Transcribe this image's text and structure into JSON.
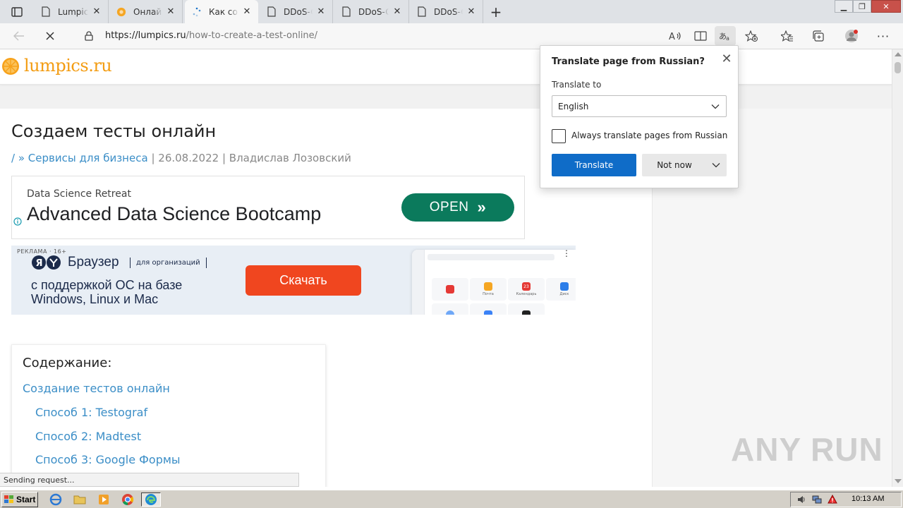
{
  "tabs": [
    {
      "title": "Lumpics",
      "icon": "page-icon"
    },
    {
      "title": "Онлайн",
      "icon": "orange-favicon"
    },
    {
      "title": "Как создать",
      "icon": "loading-spinner-icon"
    },
    {
      "title": "DDoS-G",
      "icon": "page-icon"
    },
    {
      "title": "DDoS-G",
      "icon": "page-icon"
    },
    {
      "title": "DDoS-G",
      "icon": "page-icon"
    }
  ],
  "toolbar": {
    "url_scheme_host": "https://lumpics.ru",
    "url_path": "/how-to-create-a-test-online/"
  },
  "site": {
    "logo_text": "lumpics.ru"
  },
  "article": {
    "title": "Создаем тесты онлайн",
    "breadcrumb_prefix": "/ »",
    "category": "Сервисы для бизнеса",
    "sep1": "|",
    "date": "26.08.2022",
    "sep2": "|",
    "author": "Владислав Лозовский"
  },
  "ad1": {
    "subtitle": "Data Science Retreat",
    "title": "Advanced Data Science Bootcamp",
    "button": "OPEN"
  },
  "ad2": {
    "label": "РЕКЛАМА · 16+",
    "brand": "Браузер",
    "org": "для организаций",
    "line1": "с поддержкой ОС на базе",
    "line2": "Windows, Linux и Mac",
    "button": "Скачать",
    "tiles": [
      "Почта",
      "Календарь",
      "Диск"
    ],
    "tile_badge": "23"
  },
  "toc": {
    "title": "Содержание:",
    "items": [
      "Создание тестов онлайн",
      "Способ 1: Testograf",
      "Способ 2: Madtest",
      "Способ 3: Google Формы"
    ]
  },
  "status": "Sending request...",
  "translate": {
    "title": "Translate page from Russian?",
    "label": "Translate to",
    "language": "English",
    "checkbox_label": "Always translate pages from Russian",
    "translate_button": "Translate",
    "notnow_button": "Not now"
  },
  "watermark": "ANY RUN",
  "taskbar": {
    "start": "Start",
    "clock": "10:13 AM"
  }
}
